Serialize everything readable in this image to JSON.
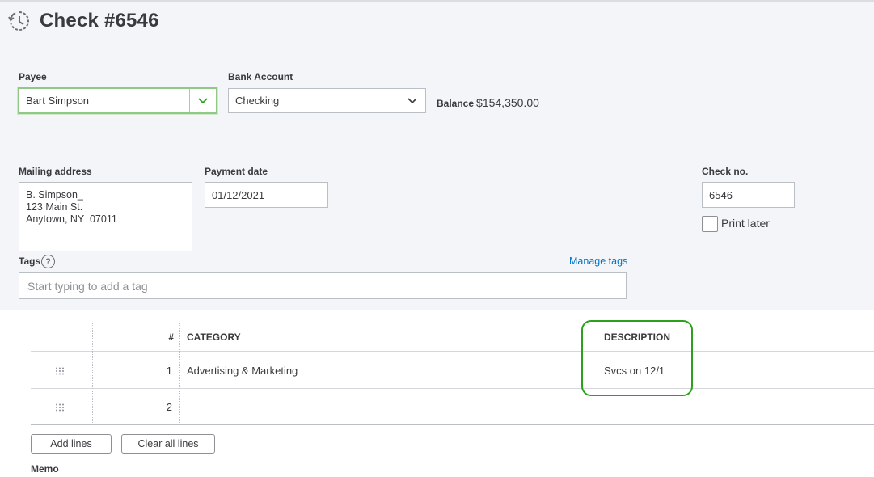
{
  "header": {
    "title": "Check #6546",
    "icon": "recurring-clock-icon"
  },
  "payee": {
    "label": "Payee",
    "value": "Bart Simpson"
  },
  "bank_account": {
    "label": "Bank Account",
    "value": "Checking"
  },
  "balance": {
    "label": "Balance",
    "value": "$154,350.00"
  },
  "mailing_address": {
    "label": "Mailing address",
    "lines": [
      "B. Simpson_",
      "123 Main St.",
      "Anytown, NY  07011"
    ]
  },
  "payment_date": {
    "label": "Payment date",
    "value": "01/12/2021"
  },
  "check_no": {
    "label": "Check no.",
    "value": "6546"
  },
  "print_later": {
    "label": "Print later",
    "checked": false
  },
  "tags": {
    "label": "Tags",
    "placeholder": "Start typing to add a tag",
    "manage_label": "Manage tags"
  },
  "table": {
    "columns": {
      "num": "#",
      "category": "CATEGORY",
      "description": "DESCRIPTION"
    },
    "rows": [
      {
        "num": "1",
        "category": "Advertising & Marketing",
        "description": "Svcs on 12/1"
      },
      {
        "num": "2",
        "category": "",
        "description": ""
      }
    ]
  },
  "buttons": {
    "add_lines": "Add lines",
    "clear_all_lines": "Clear all lines"
  },
  "memo": {
    "label": "Memo"
  },
  "colors": {
    "accent_green": "#2ca01c",
    "link_blue": "#0077c5",
    "band_bg": "#f4f5f8"
  }
}
